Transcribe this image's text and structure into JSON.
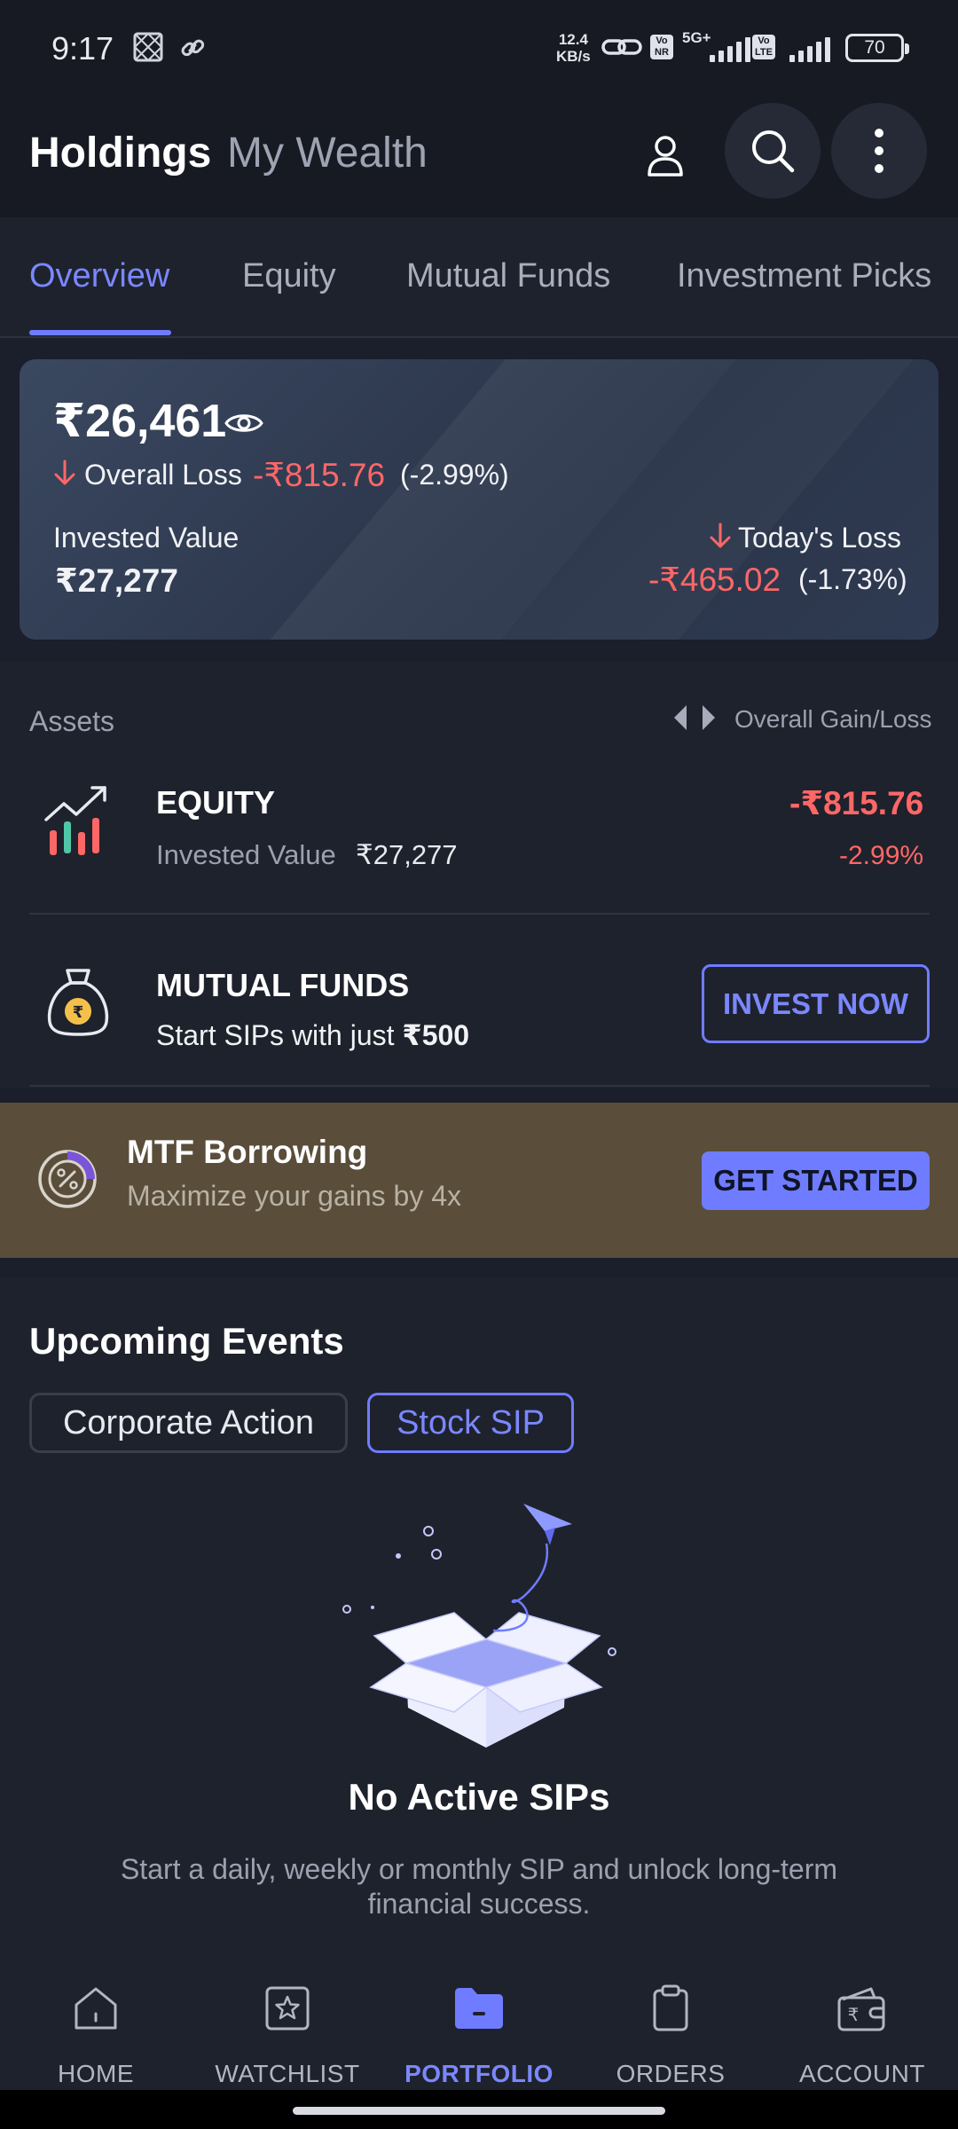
{
  "status_bar": {
    "time": "9:17",
    "net_speed_value": "12.4",
    "net_speed_unit": "KB/s",
    "network1": "5G+",
    "network2": "LTE",
    "battery": "70"
  },
  "header": {
    "title": "Holdings",
    "subtitle": "My Wealth",
    "icons": [
      "user-icon",
      "search-icon",
      "more-vertical-icon"
    ]
  },
  "tabs": [
    {
      "label": "Overview",
      "active": true
    },
    {
      "label": "Equity",
      "active": false
    },
    {
      "label": "Mutual Funds",
      "active": false
    },
    {
      "label": "Investment Picks",
      "active": false
    }
  ],
  "summary": {
    "current_value": "₹26,461",
    "overall_label": "Overall Loss",
    "overall_amount": "-₹815.76",
    "overall_pct": "(-2.99%)",
    "invested_label": "Invested Value",
    "invested_value": "₹27,277",
    "today_label": "Today's Loss",
    "today_amount": "-₹465.02",
    "today_pct": "(-1.73%)"
  },
  "assets": {
    "title": "Assets",
    "toggle_label": "Overall Gain/Loss",
    "equity": {
      "name": "EQUITY",
      "invested_label": "Invested Value",
      "invested_value": "₹27,277",
      "gain_amount": "-₹815.76",
      "gain_pct": "-2.99%"
    },
    "mutual_funds": {
      "name": "MUTUAL FUNDS",
      "subtitle_prefix": "Start SIPs with just",
      "subtitle_amount": "₹500",
      "button": "INVEST NOW"
    }
  },
  "mtf": {
    "title": "MTF Borrowing",
    "subtitle": "Maximize your gains by 4x",
    "button": "GET STARTED"
  },
  "events": {
    "title": "Upcoming Events",
    "chips": [
      {
        "label": "Corporate Action",
        "active": false
      },
      {
        "label": "Stock SIP",
        "active": true
      }
    ],
    "empty_title": "No Active SIPs",
    "empty_line1": "Start a daily, weekly or monthly SIP and unlock long-term",
    "empty_line2": "financial success."
  },
  "bottom_nav": [
    {
      "label": "HOME",
      "icon": "home-icon",
      "active": false
    },
    {
      "label": "WATCHLIST",
      "icon": "star-icon",
      "active": false
    },
    {
      "label": "PORTFOLIO",
      "icon": "folder-icon",
      "active": true
    },
    {
      "label": "ORDERS",
      "icon": "clipboard-icon",
      "active": false
    },
    {
      "label": "ACCOUNT",
      "icon": "wallet-icon",
      "active": false
    }
  ],
  "colors": {
    "accent": "#6f7cff",
    "loss": "#ff6767",
    "background": "#1b1e2b",
    "mtf_banner": "#5a4d3a"
  }
}
